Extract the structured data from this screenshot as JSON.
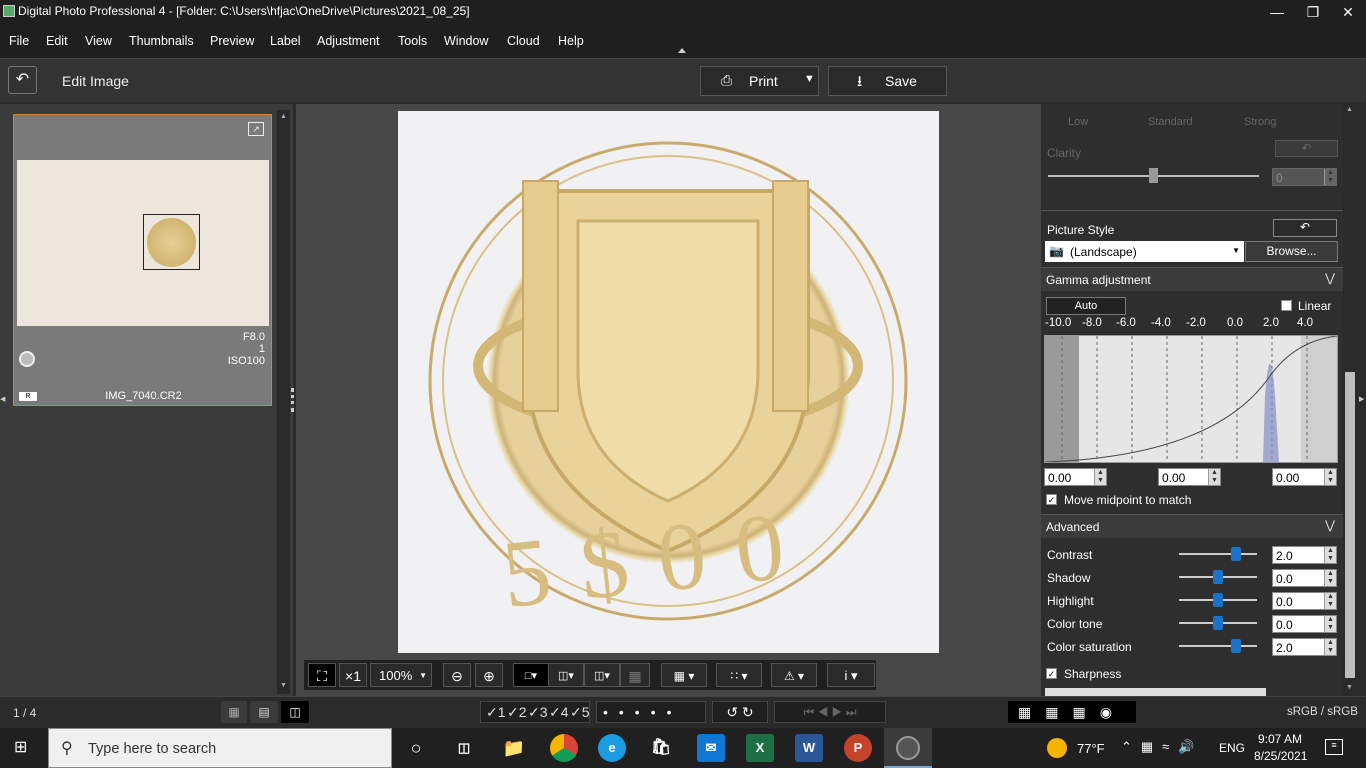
{
  "window": {
    "title": "Digital Photo Professional 4 - [Folder: C:\\Users\\hfjac\\OneDrive\\Pictures\\2021_08_25]"
  },
  "menu": [
    "File",
    "Edit",
    "View",
    "Thumbnails",
    "Preview",
    "Label",
    "Adjustment",
    "Tools",
    "Window",
    "Cloud",
    "Help"
  ],
  "toolbar": {
    "mode": "Edit Image",
    "print": "Print",
    "save": "Save"
  },
  "thumbnail": {
    "aperture": "F8.0",
    "count": "1",
    "iso": "ISO100",
    "badge": "R",
    "filename": "IMG_7040.CR2"
  },
  "photo": {
    "coin_text": "5$00"
  },
  "bottom_tools": {
    "zoom_x1": "×1",
    "zoom_percent": "100%",
    "info": "i"
  },
  "right": {
    "clarity_levels": [
      "Low",
      "Standard",
      "Strong"
    ],
    "clarity_label": "Clarity",
    "clarity_value": "0",
    "picture_style_label": "Picture Style",
    "picture_style_value": "(Landscape)",
    "browse": "Browse...",
    "gamma_label": "Gamma adjustment",
    "auto": "Auto",
    "linear": "Linear",
    "gamma_ticks": [
      "-10.0",
      "-8.0",
      "-6.0",
      "-4.0",
      "-2.0",
      "0.0",
      "2.0",
      "4.0"
    ],
    "gamma_values": [
      "0.00",
      "0.00",
      "0.00"
    ],
    "move_midpoint": "Move midpoint to match",
    "advanced_label": "Advanced",
    "advanced": [
      {
        "label": "Contrast",
        "value": "2.0",
        "level": 0.73
      },
      {
        "label": "Shadow",
        "value": "0.0",
        "level": 0.5
      },
      {
        "label": "Highlight",
        "value": "0.0",
        "level": 0.5
      },
      {
        "label": "Color tone",
        "value": "0.0",
        "level": 0.5
      },
      {
        "label": "Color saturation",
        "value": "2.0",
        "level": 0.73
      }
    ],
    "sharpness_label": "Sharpness"
  },
  "status": {
    "page": "1 / 4",
    "rating_labels": [
      "1",
      "2",
      "3",
      "4",
      "5"
    ],
    "colorspace": "sRGB / sRGB"
  },
  "taskbar": {
    "search_placeholder": "Type here to search",
    "temperature": "77°F",
    "lang": "ENG",
    "time": "9:07 AM",
    "date": "8/25/2021"
  },
  "colors": {
    "accent": "#1a73c8",
    "selection": "#c88a2a"
  }
}
